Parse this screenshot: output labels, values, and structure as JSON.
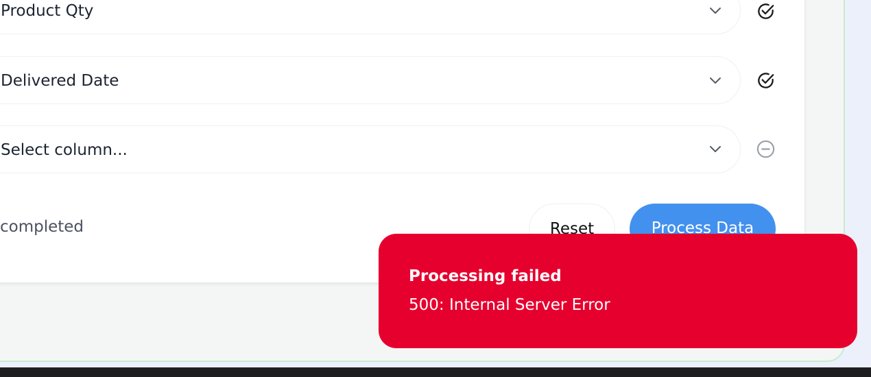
{
  "mapping_rows": [
    {
      "label": "Product Qty",
      "status": "mapped",
      "status_icon": "check-circle-icon"
    },
    {
      "label": "Delivered Date",
      "status": "mapped",
      "status_icon": "check-circle-icon"
    },
    {
      "label": "Select column...",
      "status": "unmapped",
      "status_icon": "minus-circle-icon"
    }
  ],
  "footer": {
    "progress_text": "completed",
    "reset_label": "Reset",
    "process_label": "Process Data"
  },
  "toast": {
    "title": "Processing failed",
    "message": "500: Internal Server Error"
  },
  "colors": {
    "primary_button": "#4391ee",
    "toast_error": "#e6002e",
    "panel_border": "#c5ebcd",
    "check_icon": "#1b1b1b",
    "minus_icon": "#9aa0a8"
  }
}
